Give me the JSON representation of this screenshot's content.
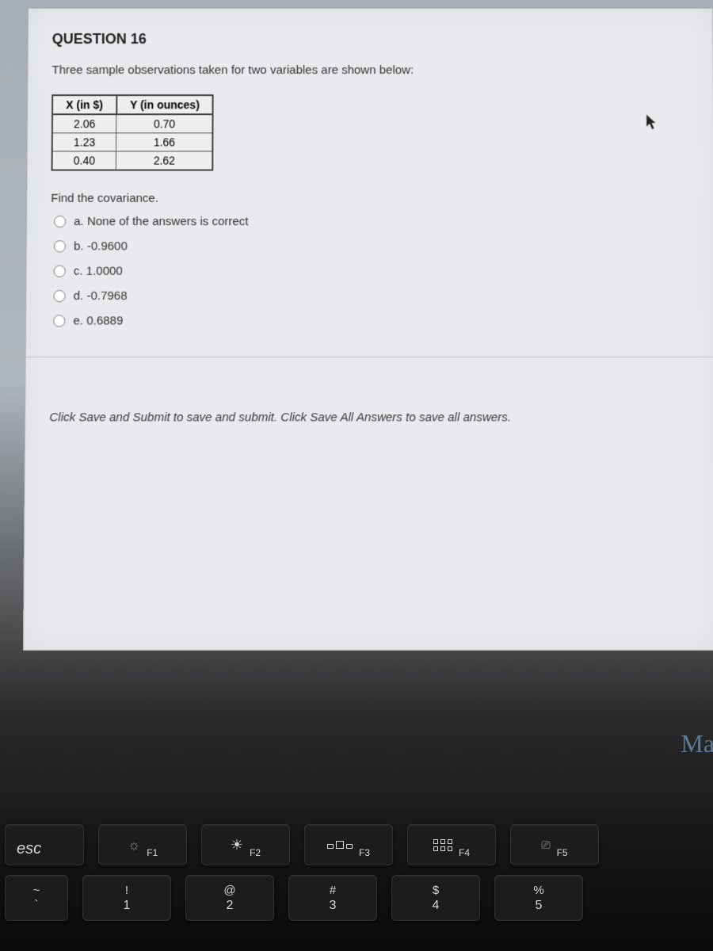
{
  "question": {
    "header": "QUESTION 16",
    "prompt": "Three sample observations taken for two variables are shown below:",
    "table": {
      "headers": [
        "X (in $)",
        "Y (in ounces)"
      ],
      "rows": [
        [
          "2.06",
          "0.70"
        ],
        [
          "1.23",
          "1.66"
        ],
        [
          "0.40",
          "2.62"
        ]
      ]
    },
    "subprompt": "Find the covariance.",
    "options": [
      "a. None of the answers is correct",
      "b. -0.9600",
      "c. 1.0000",
      "d. -0.7968",
      "e. 0.6889"
    ],
    "footer": "Click Save and Submit to save and submit. Click Save All Answers to save all answers."
  },
  "side_text": "Ma",
  "keyboard": {
    "esc": "esc",
    "fn": [
      {
        "icon": "☀",
        "label": "F1",
        "dim": true
      },
      {
        "icon": "☀",
        "label": "F2",
        "dim": false
      },
      {
        "icon": "mission",
        "label": "F3"
      },
      {
        "icon": "grid",
        "label": "F4"
      },
      {
        "icon": "⸬",
        "label": "F5"
      }
    ],
    "numrow": [
      {
        "top": "~",
        "bottom": "`"
      },
      {
        "top": "!",
        "bottom": "1"
      },
      {
        "top": "@",
        "bottom": "2"
      },
      {
        "top": "#",
        "bottom": "3"
      },
      {
        "top": "$",
        "bottom": "4"
      },
      {
        "top": "%",
        "bottom": "5"
      }
    ]
  }
}
